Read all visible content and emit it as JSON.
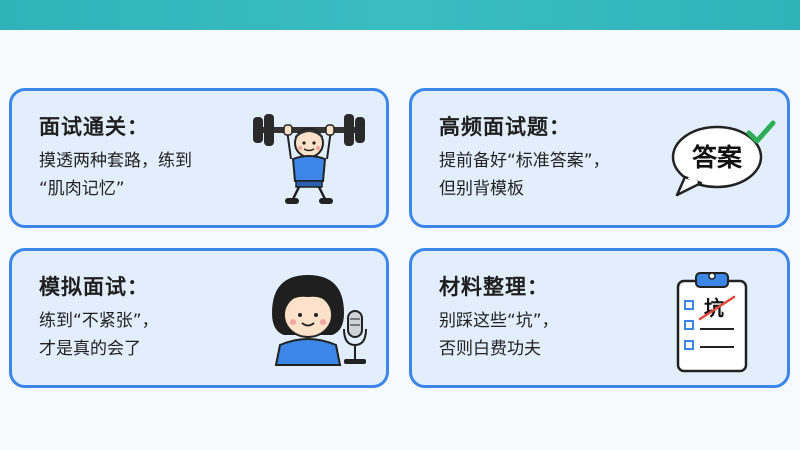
{
  "cards": [
    {
      "title": "面试通关：",
      "lines": [
        "摸透两种套路，练到",
        "“肌肉记忆”"
      ],
      "icon": "weightlifter-icon"
    },
    {
      "title": "高频面试题：",
      "lines": [
        "提前备好“标准答案”，",
        "但别背模板"
      ],
      "icon": "answer-bubble-icon",
      "bubble_text": "答案"
    },
    {
      "title": "模拟面试：",
      "lines": [
        "练到“不紧张”，",
        "才是真的会了"
      ],
      "icon": "girl-microphone-icon"
    },
    {
      "title": "材料整理：",
      "lines": [
        "别踩这些“坑”，",
        "否则白费功夫"
      ],
      "icon": "clipboard-checklist-icon",
      "clipboard_text": "坑"
    }
  ],
  "colors": {
    "top_bar": "#2fb3b9",
    "card_border": "#3b86e6",
    "card_fill": "#e3eefc",
    "check": "#2fae5a",
    "strike": "#e0463c"
  }
}
